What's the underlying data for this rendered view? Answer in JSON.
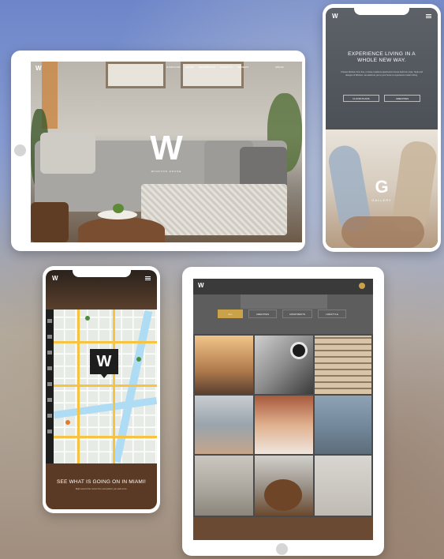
{
  "tablet_landscape": {
    "logo": "W",
    "hero_logo": "W",
    "hero_subtitle": "WINSTON HOUSE",
    "phone_text": "(305) 000",
    "nav": [
      "FLOOR PLANS",
      "GALLERY",
      "NEIGHBORHOOD",
      "CONTACT US",
      "RESIDENTS"
    ]
  },
  "phone_top": {
    "logo": "W",
    "headline": "EXPERIENCE LIVING IN A WHOLE NEW WAY.",
    "body": "Choose Winston from fine, or these residents apartments homes built from style. Style and designs of Winston, we welcome you to your home to experience modern living.",
    "btn_floorplans": "FLOOR PLANS",
    "btn_amenities": "AMENITIES",
    "gallery_letter": "G",
    "gallery_label": "GALLERY"
  },
  "phone_map": {
    "logo": "W",
    "map_pin_logo": "W",
    "footer_title": "SEE WHAT IS GOING ON IN MIAMI!",
    "footer_sub": "Right around the corner from everywhere you want to be."
  },
  "tablet_portrait": {
    "logo": "W",
    "tabs": [
      "ALL",
      "AMENITIES",
      "APARTMENTS",
      "LIFESTYLE"
    ]
  },
  "colors": {
    "brown": "#5a3a24",
    "gold": "#c9a24a",
    "map_water": "#aedcf5",
    "map_road": "#f6c342"
  }
}
